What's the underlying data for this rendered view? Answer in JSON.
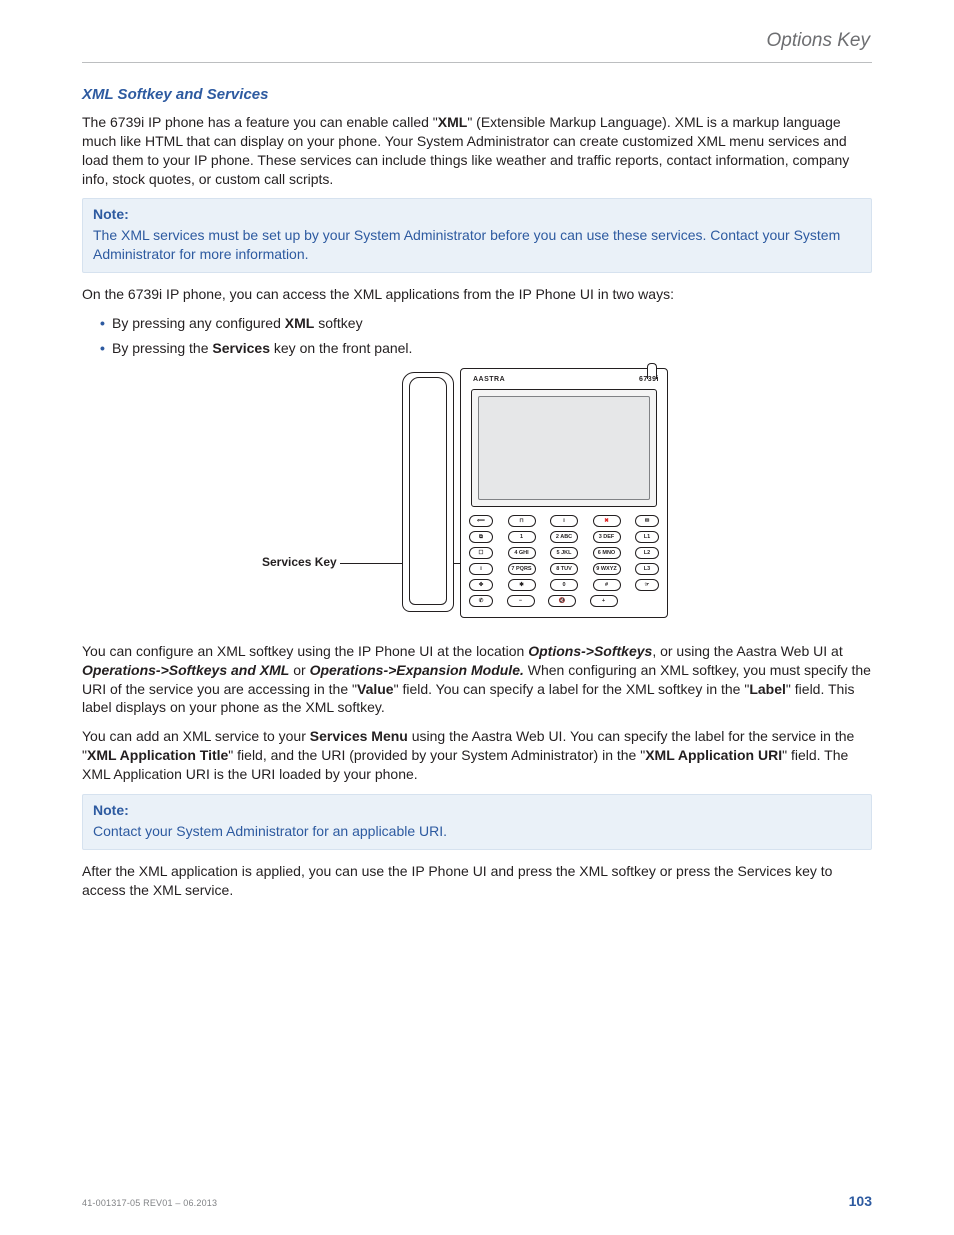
{
  "running_head": "Options Key",
  "section": {
    "title": "XML Softkey and Services",
    "intro_html": "The 6739i IP phone has a feature you can enable called \"<strong>XML</strong>\" (Extensible Markup Language). XML is a markup language much like HTML that can display on your phone. Your System Administrator can create customized XML menu services and load them to your IP phone. These services can include things like weather and traffic reports, contact information, company info, stock quotes, or custom call scripts.",
    "note1": {
      "title": "Note:",
      "body": "The XML services must be set up by your System Administrator before you can use these services. Contact your System Administrator for more information."
    },
    "access_intro": "On the 6739i IP phone, you can access the XML applications from the IP Phone UI in two ways:",
    "bullets": [
      "By pressing any configured <strong>XML</strong> softkey",
      "By pressing the <strong>Services</strong> key on the front panel."
    ],
    "diagram": {
      "callout": "Services Key",
      "brand_left": "AASTRA",
      "brand_right": "6739i",
      "keypad": {
        "row1": {
          "l": "⟸",
          "c1": "⊓",
          "c2": "i",
          "c3": "✖",
          "r": "✉"
        },
        "row2": {
          "l": "⧉",
          "c1": "1",
          "c2": "2 ABC",
          "c3": "3 DEF",
          "r": "L1"
        },
        "row3": {
          "l": "☐",
          "c1": "4 GHI",
          "c2": "5 JKL",
          "c3": "6 MNO",
          "r": "L2"
        },
        "row4": {
          "l": "i",
          "c1": "7 PQRS",
          "c2": "8 TUV",
          "c3": "9 WXYZ",
          "r": "L3"
        },
        "row5": {
          "l": "✥",
          "c1": "✱",
          "c2": "0",
          "c3": "#",
          "r": "☞"
        },
        "row6": {
          "l": "✆",
          "c1": "−",
          "c2": "🔇",
          "c3": "+"
        }
      }
    },
    "config_para_html": "You can configure an XML softkey using the IP Phone UI at the location <strong><em>Options-&gt;Softkeys</em></strong>, or using the Aastra Web UI at <strong><em>Operations-&gt;Softkeys and XML</em></strong> or <strong><em>Operations-&gt;Expansion Module.</em></strong> When configuring an XML softkey, you must specify the URI of the service you are accessing in the \"<strong>Value</strong>\" field. You can specify a label for the XML softkey in the \"<strong>Label</strong>\" field. This label displays on your phone as the XML softkey.",
    "add_para_html": "You can add an XML service to your <strong>Services Menu</strong> using the Aastra Web UI. You can specify the label for the service in the \"<strong>XML Application Title</strong>\" field, and the URI (provided by your System Administrator) in the \"<strong>XML Application URI</strong>\" field. The XML Application URI is the URI loaded by your phone.",
    "note2": {
      "title": "Note:",
      "body": "Contact your System Administrator for an applicable URI."
    },
    "closing": "After the XML application is applied, you can use the IP Phone UI and press the XML softkey or press the Services key to access the XML service."
  },
  "footer": {
    "left": "41-001317-05 REV01 – 06.2013",
    "page": "103"
  }
}
